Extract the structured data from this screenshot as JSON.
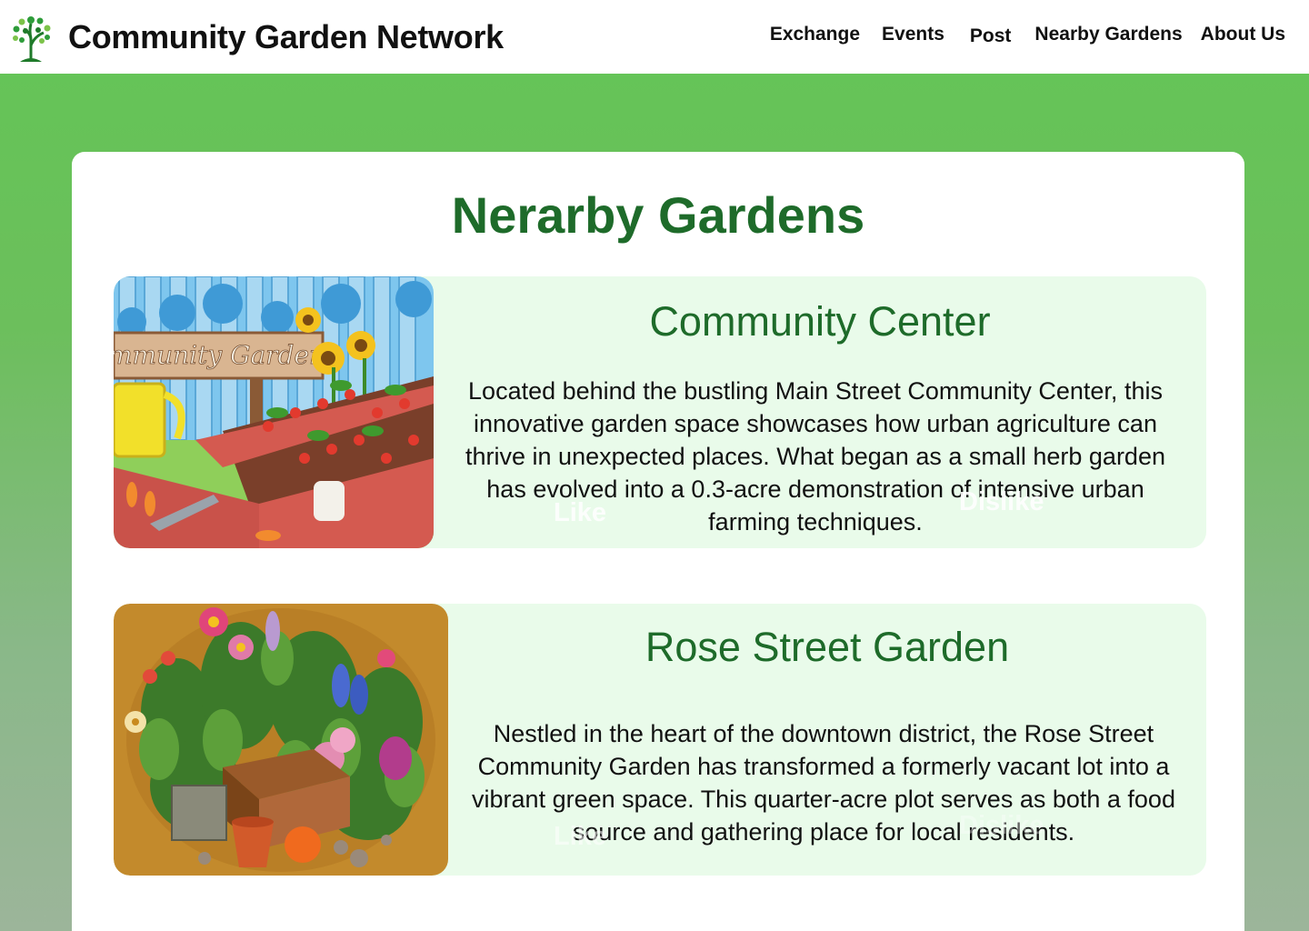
{
  "header": {
    "site_title": "Community Garden Network",
    "nav": [
      "Exchange",
      "Events",
      "Post",
      "Nearby Gardens",
      "About Us"
    ]
  },
  "main": {
    "title": "Nerarby Gardens",
    "gardens": [
      {
        "name": "Community Center",
        "image_sign_text": "mmunity Garden",
        "description": "Located behind the bustling Main Street Community Center, this innovative garden space showcases how urban agriculture can thrive in unexpected places. What began as a small herb garden has evolved into a 0.3-acre demonstration of intensive urban farming techniques.",
        "like_label": "Like",
        "dislike_label": "Dislike"
      },
      {
        "name": "Rose Street Garden",
        "description": "Nestled in the heart of the downtown district, the Rose Street Community Garden has transformed a formerly vacant lot into a vibrant green space. This quarter-acre plot serves as both a food source and gathering place for local residents.",
        "like_label": "Like",
        "dislike_label": "Dislike"
      }
    ]
  },
  "colors": {
    "accent": "#1e6b2a",
    "card_bg": "#e9fbea",
    "page_bg_top": "#63c556",
    "page_bg_bottom": "#9cb59a"
  }
}
